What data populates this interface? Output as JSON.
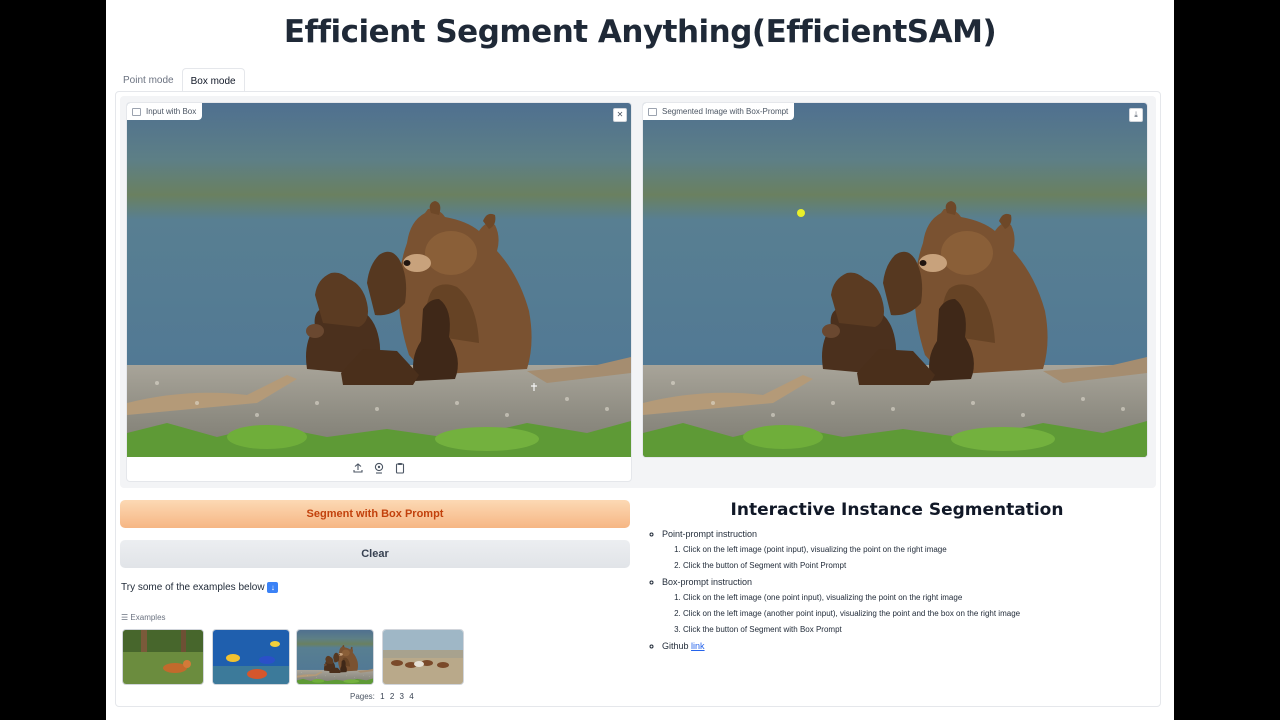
{
  "app": {
    "title": "Efficient Segment Anything(EfficientSAM)"
  },
  "tabs": [
    {
      "label": "Point mode",
      "active": false
    },
    {
      "label": "Box mode",
      "active": true
    }
  ],
  "input_image": {
    "label": "Input with Box",
    "close_icon": "close-icon",
    "toolbar_icons": [
      "upload-icon",
      "webcam-icon",
      "clipboard-icon"
    ]
  },
  "output_image": {
    "label": "Segmented Image with Box-Prompt",
    "download_icon": "download-icon",
    "point_color": "#e9f02a"
  },
  "buttons": {
    "segment": "Segment with Box Prompt",
    "clear": "Clear"
  },
  "examples": {
    "try_text": "Try some of the examples below",
    "try_icon": "⬇️",
    "label": "Examples",
    "thumbnails": [
      "dog on grass",
      "aquarium fish",
      "bears by lake",
      "horses running"
    ],
    "pages_label": "Pages:",
    "pages": [
      "1",
      "2",
      "3",
      "4"
    ]
  },
  "instructions": {
    "heading": "Interactive Instance Segmentation",
    "point_title": "Point-prompt instruction",
    "point_steps": [
      "Click on the left image (point input), visualizing the point on the right image",
      "Click the button of Segment with Point Prompt"
    ],
    "box_title": "Box-prompt instruction",
    "box_steps": [
      "Click on the left image (one point input), visualizing the point on the right image",
      "Click on the left image (another point input), visualizing the point and the box on the right image",
      "Click the button of Segment with Box Prompt"
    ],
    "github_text": "Github",
    "github_link": "link"
  },
  "colors": {
    "primary_button_text": "#c2410c",
    "link": "#2563eb"
  }
}
